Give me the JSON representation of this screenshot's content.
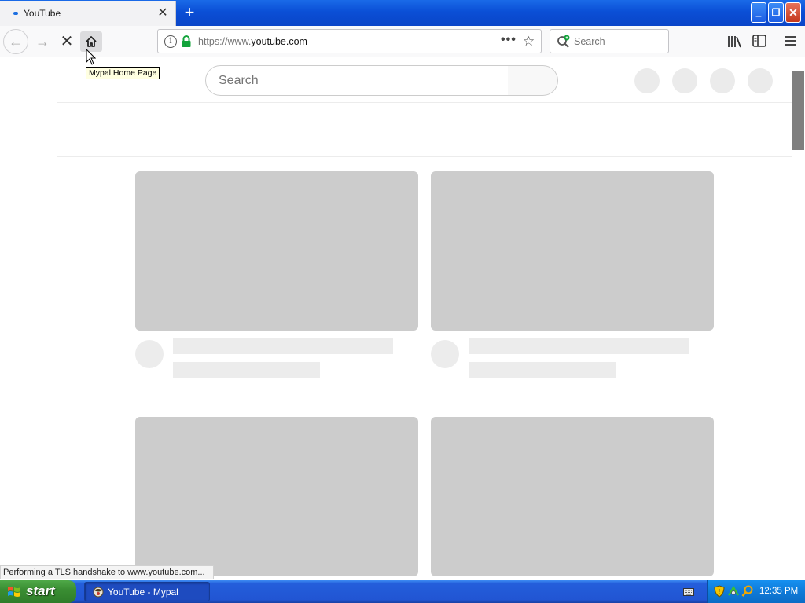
{
  "browser": {
    "tab_title": "YouTube",
    "tab_close": "✕",
    "new_tab": "+",
    "url_prefix": "https://www.",
    "url_domain": "youtube.com",
    "search_placeholder": "Search",
    "home_tooltip": "Mypal Home Page",
    "status_text": "Performing a TLS handshake to www.youtube.com..."
  },
  "page": {
    "search_placeholder": "Search"
  },
  "taskbar": {
    "start_label": "start",
    "window_title": "YouTube - Mypal",
    "clock": "12:35 PM"
  },
  "colors": {
    "accent": "#1d6fe0",
    "skeleton_dark": "#cccccc",
    "skeleton_light": "#ececec"
  }
}
